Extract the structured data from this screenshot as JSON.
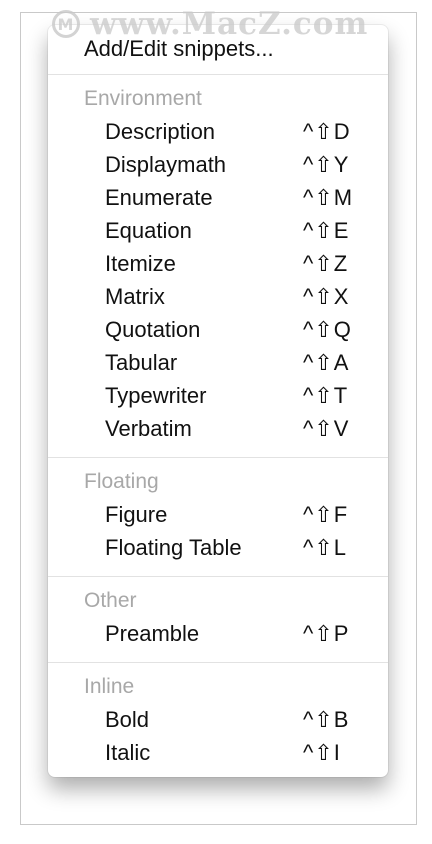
{
  "watermark": {
    "text": "www.MacZ.com",
    "logo_text": "M"
  },
  "menu": {
    "top_item": "Add/Edit snippets...",
    "sections": [
      {
        "header": "Environment",
        "items": [
          {
            "label": "Description",
            "shortcut": "^⇧D"
          },
          {
            "label": "Displaymath",
            "shortcut": "^⇧Y"
          },
          {
            "label": "Enumerate",
            "shortcut": "^⇧M"
          },
          {
            "label": "Equation",
            "shortcut": "^⇧E"
          },
          {
            "label": "Itemize",
            "shortcut": "^⇧Z"
          },
          {
            "label": "Matrix",
            "shortcut": "^⇧X"
          },
          {
            "label": "Quotation",
            "shortcut": "^⇧Q"
          },
          {
            "label": "Tabular",
            "shortcut": "^⇧A"
          },
          {
            "label": "Typewriter",
            "shortcut": "^⇧T"
          },
          {
            "label": "Verbatim",
            "shortcut": "^⇧V"
          }
        ]
      },
      {
        "header": "Floating",
        "items": [
          {
            "label": "Figure",
            "shortcut": "^⇧F"
          },
          {
            "label": "Floating Table",
            "shortcut": "^⇧L"
          }
        ]
      },
      {
        "header": "Other",
        "items": [
          {
            "label": "Preamble",
            "shortcut": "^⇧P"
          }
        ]
      },
      {
        "header": "Inline",
        "items": [
          {
            "label": "Bold",
            "shortcut": "^⇧B"
          },
          {
            "label": "Italic",
            "shortcut": "^⇧I"
          }
        ]
      }
    ]
  }
}
